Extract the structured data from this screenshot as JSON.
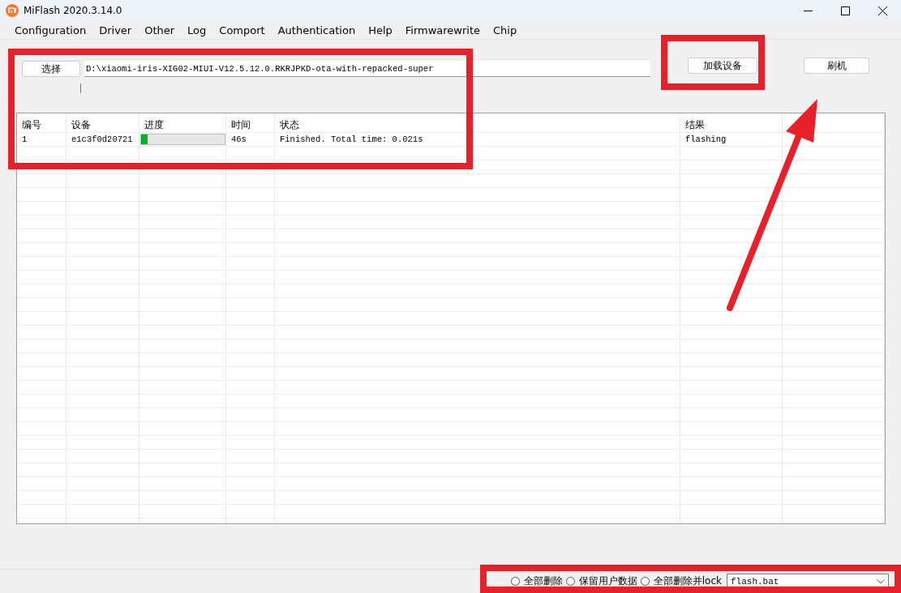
{
  "window": {
    "title": "MiFlash 2020.3.14.0"
  },
  "menu": [
    "Configuration",
    "Driver",
    "Other",
    "Log",
    "Comport",
    "Authentication",
    "Help",
    "Firmwarewrite",
    "Chip"
  ],
  "select_button": "选择",
  "path_field": {
    "value": "D:\\xiaomi-iris-XIG02-MIUI-V12.5.12.0.RKRJPKD-ota-with-repacked-super"
  },
  "load_device_button": "加载设备",
  "flash_button": "刷机",
  "table": {
    "columns": [
      "编号",
      "设备",
      "进度",
      "时间",
      "状态",
      "结果"
    ],
    "rows": [
      {
        "number": "1",
        "device": "e1c3f0d20721",
        "progress": {
          "level": 0.08
        },
        "time": "46s",
        "status": "Finished. Total time: 0.021s",
        "result": "flashing"
      }
    ]
  },
  "options": [
    {
      "label": "全部删除",
      "selected": false
    },
    {
      "label": "保留用户数据",
      "selected": false
    },
    {
      "label": "全部删除并lock",
      "selected": false
    }
  ],
  "script_combo": {
    "value": "flash.bat"
  }
}
